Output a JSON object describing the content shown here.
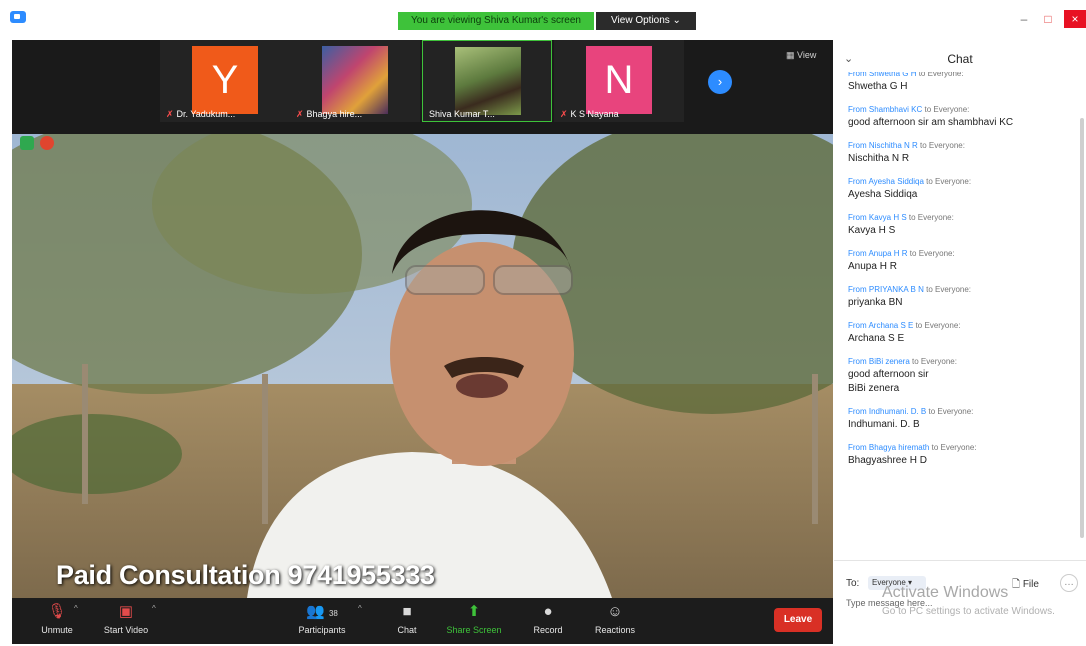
{
  "window": {
    "banner_text": "You are viewing Shiva Kumar's screen",
    "view_options_label": "View Options ⌄",
    "minimize": "–",
    "maximize": "□",
    "close": "×"
  },
  "strip": {
    "thumbnails": [
      {
        "letter": "Y",
        "name": "Dr. Yadukum...",
        "color": "#f05a1a",
        "muted": true
      },
      {
        "letter": "",
        "name": "Bhagya hire...",
        "color": "#6d4f7e",
        "muted": true
      },
      {
        "letter": "",
        "name": "Shiva Kumar T...",
        "color": "#5d7a3e",
        "muted": false
      },
      {
        "letter": "N",
        "name": "K S Nayana",
        "color": "#e8447d",
        "muted": true
      }
    ],
    "next_icon": "›",
    "view_label": "View"
  },
  "video": {
    "overlay_text": "Paid Consultation 9741955333"
  },
  "toolbar": {
    "unmute_label": "Unmute",
    "start_video_label": "Start Video",
    "participants_label": "Participants",
    "participants_count": "38",
    "chat_label": "Chat",
    "share_screen_label": "Share Screen",
    "record_label": "Record",
    "reactions_label": "Reactions",
    "leave_label": "Leave",
    "share_color": "#3ec23a"
  },
  "chat": {
    "title": "Chat",
    "collapse_icon": "⌄",
    "messages": [
      {
        "from": "From Shwetha G H",
        "to_text": " to Everyone:",
        "body": "Shwetha G H"
      },
      {
        "from": "From Shambhavi KC",
        "to_text": " to Everyone:",
        "body": "good afternoon sir am shambhavi KC"
      },
      {
        "from": "From Nischitha N R",
        "to_text": " to Everyone:",
        "body": "Nischitha N R"
      },
      {
        "from": "From Ayesha Siddiqa",
        "to_text": " to Everyone:",
        "body": "Ayesha Siddiqa"
      },
      {
        "from": "From Kavya H S",
        "to_text": " to Everyone:",
        "body": "Kavya H S"
      },
      {
        "from": "From Anupa H R",
        "to_text": " to Everyone:",
        "body": "Anupa H R"
      },
      {
        "from": "From PRIYANKA B N",
        "to_text": " to Everyone:",
        "body": "priyanka BN"
      },
      {
        "from": "From Archana S E",
        "to_text": " to Everyone:",
        "body": "Archana S E"
      },
      {
        "from": "From BiBi zenera",
        "to_text": " to Everyone:",
        "body": "good afternoon sir\nBiBi zenera"
      },
      {
        "from": "From Indhumani. D. B",
        "to_text": " to Everyone:",
        "body": "Indhumani. D. B"
      },
      {
        "from": "From Bhagya hiremath",
        "to_text": " to Everyone:",
        "body": "Bhagyashree H D"
      }
    ],
    "to_label": "To:",
    "to_value": "Everyone ▾",
    "file_label": "File",
    "more_icon": "…",
    "input_placeholder": "Type message here...",
    "watermark_title": "Activate Windows",
    "watermark_sub": "Go to PC settings to activate Windows."
  }
}
